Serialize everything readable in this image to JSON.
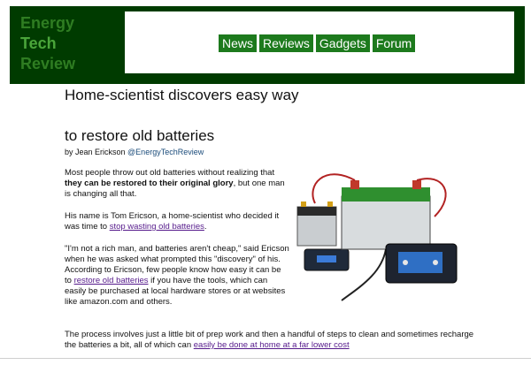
{
  "site": {
    "logo": [
      "Energy",
      "Tech",
      "Review"
    ]
  },
  "nav": {
    "items": [
      "News",
      "Reviews",
      "Gadgets",
      "Forum"
    ]
  },
  "article": {
    "title_line1": "Home-scientist discovers easy way",
    "title_line2": "to restore old batteries",
    "byline_prefix": "by Jean Erickson ",
    "byline_handle": "@EnergyTechReview",
    "p1_a": "Most people throw out old batteries without realizing that ",
    "p1_bold": "they can be restored to their original glory",
    "p1_b": ", but one man is changing all that.",
    "p2_a": "His name is Tom Ericson, a home-scientist who decided it was time to ",
    "p2_link": "stop wasting old batteries",
    "p2_b": ".",
    "p3_a": "\"I'm not a rich man, and batteries aren't cheap,\" said Ericson when he was asked what prompted this \"discovery\" of his. According to Ericson, few people know how easy it can be to ",
    "p3_link": "restore old batteries",
    "p3_b": " if you have the tools, which can easily be purchased at local hardware stores or at websites like amazon.com and others.",
    "p4_a": "The process involves just a little bit of prep work and then a handful of steps to clean and sometimes recharge the batteries a bit, all of which can ",
    "p4_link": "easily be done at home at a far lower cost"
  },
  "colors": {
    "header_bg": "#003b00",
    "nav_bg": "#1d7a1d",
    "link": "#551a8b"
  }
}
